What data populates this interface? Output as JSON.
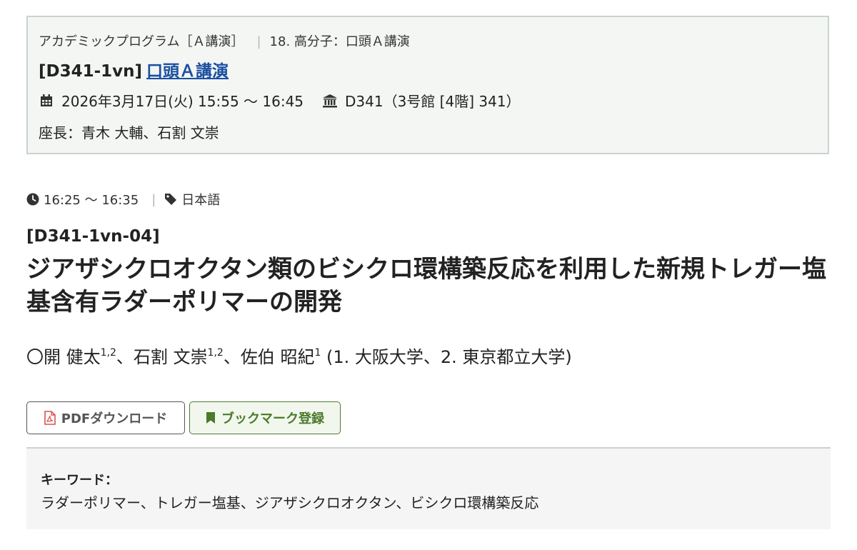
{
  "session": {
    "program": "アカデミックプログラム［Ａ講演］",
    "category": "18. 高分子：口頭Ａ講演",
    "code": "[D341-1vn]",
    "link_label": "口頭Ａ講演",
    "datetime": "2026年3月17日(火) 15:55 〜 16:45",
    "room": "D341（3号館 [4階] 341）",
    "chair": "座長：青木 大輔、石割 文崇"
  },
  "talk": {
    "time": "16:25 〜 16:35",
    "language": "日本語",
    "code": "[D341-1vn-04]",
    "title": "ジアザシクロオクタン類のビシクロ環構築反応を利用した新規トレガー塩基含有ラダーポリマーの開発",
    "authors": {
      "a1_name": "〇開 健太",
      "a1_aff": "1,2",
      "a2_name": "、石割 文崇",
      "a2_aff": "1,2",
      "a3_name": "、佐伯 昭紀",
      "a3_aff": "1",
      "affiliations": " (1. 大阪大学、2. 東京都立大学)"
    }
  },
  "buttons": {
    "pdf": "PDFダウンロード",
    "bookmark": "ブックマーク登録"
  },
  "keywords": {
    "label": "キーワード：",
    "values": "ラダーポリマー、トレガー塩基、ジアザシクロオクタン、ビシクロ環構築反応"
  },
  "icons": {
    "calendar": "calendar-icon",
    "room": "building-icon",
    "clock": "clock-icon",
    "tag": "tag-icon",
    "pdf": "pdf-file-icon",
    "bookmark": "bookmark-icon"
  },
  "colors": {
    "link": "#1a4fa0",
    "bookmark_accent": "#4a7a2a",
    "pdf_icon": "#d9534f",
    "session_bg": "#f4f6f4",
    "session_border": "#c9d3cf"
  }
}
